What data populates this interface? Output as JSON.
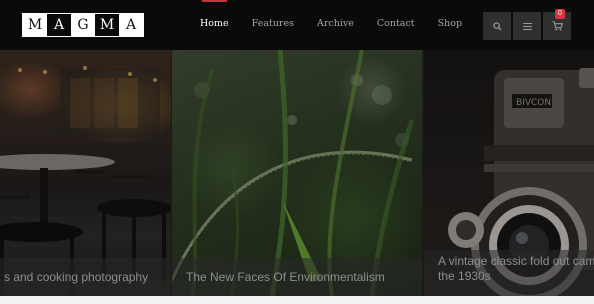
{
  "logo": {
    "letters": [
      "M",
      "A",
      "G",
      "M",
      "A"
    ]
  },
  "nav": {
    "items": [
      {
        "label": "Home",
        "active": true
      },
      {
        "label": "Features",
        "active": false
      },
      {
        "label": "Archive",
        "active": false
      },
      {
        "label": "Contact",
        "active": false
      },
      {
        "label": "Shop",
        "active": false
      }
    ]
  },
  "actions": {
    "search_icon": "search-icon",
    "menu_icon": "hamburger-menu-icon",
    "cart_icon": "cart-icon",
    "cart_count": "0"
  },
  "slides": [
    {
      "caption": "s and cooking photography",
      "image": "restaurant-interior"
    },
    {
      "caption": "The New Faces Of Environmentalism",
      "image": "grass-with-dew"
    },
    {
      "caption_line1": "A vintage classic fold out cam",
      "caption_line2": "the 1930s",
      "image": "vintage-camera"
    }
  ],
  "colors": {
    "accent": "#c8333a",
    "header_bg": "#0a0a0a",
    "badge": "#d6343c"
  }
}
